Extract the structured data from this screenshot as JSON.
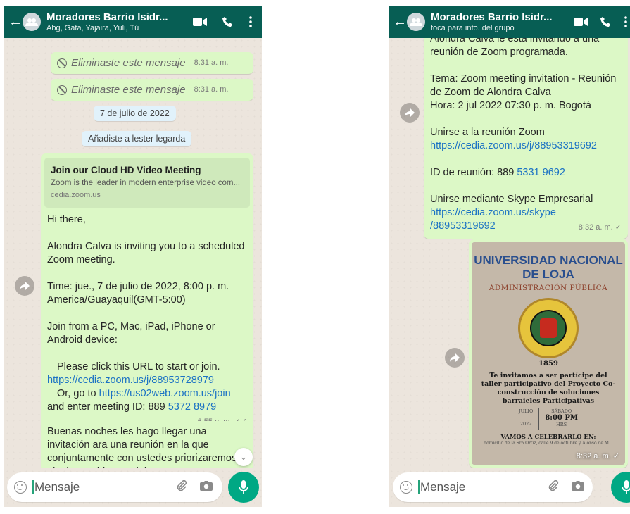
{
  "left": {
    "header": {
      "title": "Moradores Barrio Isidr...",
      "subtitle": "Abg, Gata, Yajaira, Yuli, Tú"
    },
    "deleted1": {
      "text": "Eliminaste este mensaje",
      "time": "8:31 a. m."
    },
    "deleted2": {
      "text": "Eliminaste este mensaje",
      "time": "8:31 a. m."
    },
    "date_chip": "7 de julio de 2022",
    "sys_chip": "Añadiste a lester legarda",
    "zoom_msg": {
      "preview_title": "Join our Cloud HD Video Meeting",
      "preview_desc": "Zoom is the leader in modern enterprise video com...",
      "preview_domain": "cedia.zoom.us",
      "p1": "Hi there,",
      "p2": "Alondra Calva is inviting you to a scheduled Zoom meeting.",
      "p3": "Time: jue., 7 de julio de 2022, 8:00 p. m. America/Guayaquil(GMT-5:00)",
      "p4": "Join from a PC, Mac, iPad, iPhone or Android device:",
      "p5_a": "Please click this URL to start or join.",
      "p5_link": "https://cedia.zoom.us/j/88953728979",
      "p5_b": "Or, go to",
      "p5_link2": "https://us02web.zoom.us/join",
      "p5_c": "and enter meeting ID: 889",
      "p5_id": "5372 8979",
      "time": "6:55 p. m."
    },
    "next_msg": {
      "text": "Buenas noches les hago llegar una invitación ara una reunión en la que conjuntamente con ustedes priorizaremos el o los problemas del"
    },
    "input_placeholder": "Mensaje"
  },
  "right": {
    "header": {
      "title": "Moradores Barrio Isidr...",
      "subtitle": "toca para info. del grupo"
    },
    "zoom_msg": {
      "p1": "Alondra Calva le está invitando a una reunión de Zoom programada.",
      "p2": "Tema: Zoom meeting invitation - Reunión de Zoom de Alondra Calva",
      "p3": "Hora: 2 jul 2022 07:30 p. m. Bogotá",
      "p4_a": "Unirse a la reunión Zoom",
      "p4_link": "https://cedia.zoom.us/j/88953319692",
      "p5_a": "ID de reunión: 889",
      "p5_id": "5331 9692",
      "p6_a": "Unirse mediante Skype Empresarial",
      "p6_link": "https://cedia.zoom.us/skype /88953319692",
      "time": "8:32 a. m."
    },
    "flyer": {
      "university": "UNIVERSIDAD NACIONAL DE LOJA",
      "department": "ADMINISTRACIÓN PÚBLICA",
      "seal_year": "1859",
      "invite_text": "Te invitamos a ser partícipe del taller participativo del Proyecto Co-construcción de soluciones barraieles Participativas",
      "month": "JULIO",
      "year": "2022",
      "weekday": "SÁBADO",
      "time": "8:00 PM",
      "hrs": "HRS",
      "celebrate": "VAMOS A CELEBRARLO EN:",
      "address": "domicilio de la Sra Ortiz, calle 9 de octubre y Alonso de M...",
      "msg_time": "8:32 a. m."
    },
    "input_placeholder": "Mensaje"
  },
  "colors": {
    "header": "#075e54",
    "bubble": "#dcf8c6",
    "mic": "#00a884",
    "link": "#1b72c4"
  }
}
